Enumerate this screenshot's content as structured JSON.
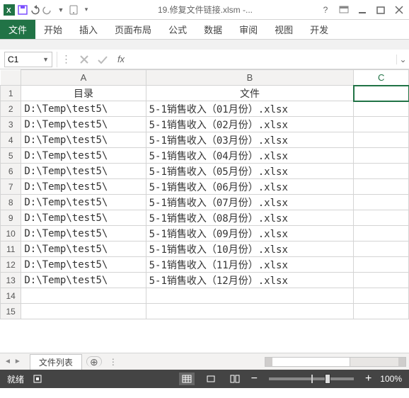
{
  "window": {
    "title": "19.修复文件链接.xlsm -..."
  },
  "ribbon": {
    "file": "文件",
    "tabs": [
      "开始",
      "插入",
      "页面布局",
      "公式",
      "数据",
      "审阅",
      "视图",
      "开发"
    ]
  },
  "namebox": {
    "value": "C1"
  },
  "formula": "",
  "columns": {
    "A": "A",
    "B": "B",
    "C": "C"
  },
  "headers": {
    "A": "目录",
    "B": "文件"
  },
  "rows": [
    {
      "a": "D:\\Temp\\test5\\",
      "b": "5-1销售收入（01月份）.xlsx"
    },
    {
      "a": "D:\\Temp\\test5\\",
      "b": "5-1销售收入（02月份）.xlsx"
    },
    {
      "a": "D:\\Temp\\test5\\",
      "b": "5-1销售收入（03月份）.xlsx"
    },
    {
      "a": "D:\\Temp\\test5\\",
      "b": "5-1销售收入（04月份）.xlsx"
    },
    {
      "a": "D:\\Temp\\test5\\",
      "b": "5-1销售收入（05月份）.xlsx"
    },
    {
      "a": "D:\\Temp\\test5\\",
      "b": "5-1销售收入（06月份）.xlsx"
    },
    {
      "a": "D:\\Temp\\test5\\",
      "b": "5-1销售收入（07月份）.xlsx"
    },
    {
      "a": "D:\\Temp\\test5\\",
      "b": "5-1销售收入（08月份）.xlsx"
    },
    {
      "a": "D:\\Temp\\test5\\",
      "b": "5-1销售收入（09月份）.xlsx"
    },
    {
      "a": "D:\\Temp\\test5\\",
      "b": "5-1销售收入（10月份）.xlsx"
    },
    {
      "a": "D:\\Temp\\test5\\",
      "b": "5-1销售收入（11月份）.xlsx"
    },
    {
      "a": "D:\\Temp\\test5\\",
      "b": "5-1销售收入（12月份）.xlsx"
    }
  ],
  "sheet": {
    "active": "文件列表"
  },
  "status": {
    "ready": "就绪",
    "zoom": "100%"
  }
}
